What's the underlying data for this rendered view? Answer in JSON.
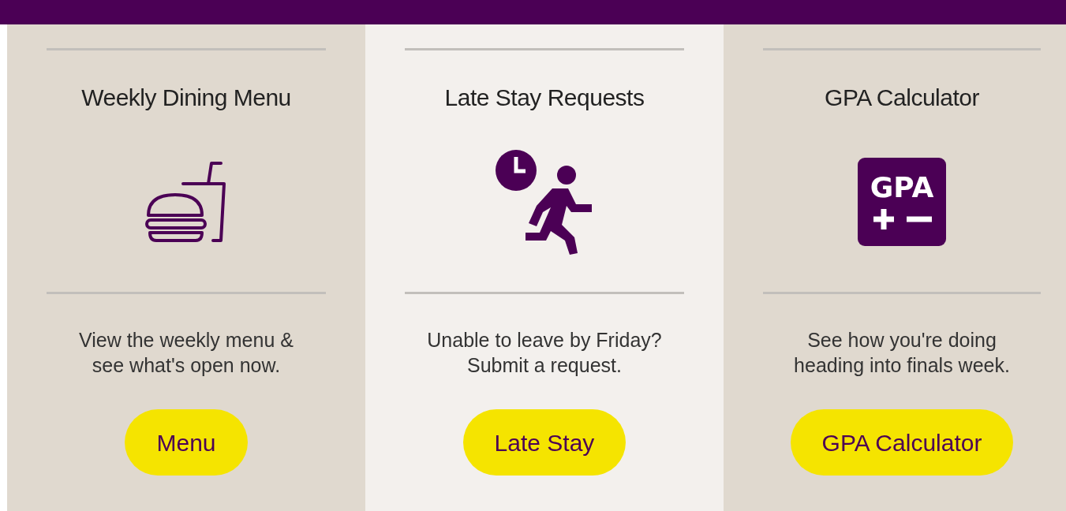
{
  "cards": [
    {
      "title": "Weekly Dining Menu",
      "kind": "food",
      "description_lines": [
        "View the weekly menu &",
        "see what's open now."
      ],
      "button": "Menu",
      "highlighted": false
    },
    {
      "title": "Late Stay Requests",
      "kind": "late",
      "description_lines": [
        "Unable to leave by Friday?",
        "Submit a request."
      ],
      "button": "Late Stay",
      "highlighted": true
    },
    {
      "title": "GPA Calculator",
      "kind": "gpa",
      "icon_label": "GPA",
      "description_lines": [
        "See how you're doing",
        "heading into finals week."
      ],
      "button": "GPA Calculator",
      "highlighted": false
    }
  ]
}
